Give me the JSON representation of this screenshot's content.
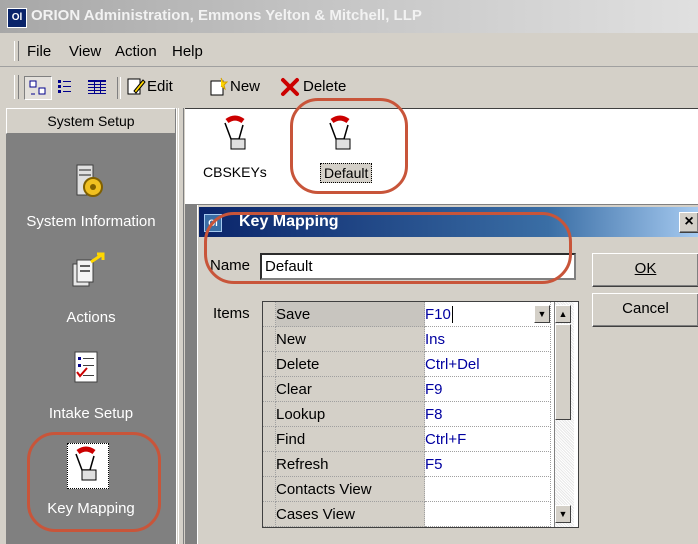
{
  "window": {
    "title": "ORION Administration, Emmons Yelton & Mitchell, LLP",
    "app_icon": "Ol"
  },
  "menu": [
    "File",
    "View",
    "Action",
    "Help"
  ],
  "toolbar": {
    "edit_label": "Edit",
    "new_label": "New",
    "delete_label": "Delete"
  },
  "sidebar": {
    "header": "System Setup",
    "items": [
      {
        "label": "System Information",
        "icon": "server-gear-icon"
      },
      {
        "label": "Actions",
        "icon": "actions-icon"
      },
      {
        "label": "Intake Setup",
        "icon": "checklist-icon"
      },
      {
        "label": "Key Mapping",
        "icon": "hand-key-icon",
        "selected": true
      }
    ]
  },
  "keymaps": [
    {
      "label": "CBSKEYs"
    },
    {
      "label": "Default",
      "selected": true
    }
  ],
  "dialog": {
    "title": "Key Mapping",
    "close_label": "×",
    "name_label": "Name",
    "name_value": "Default",
    "items_label": "Items",
    "ok_label": "OK",
    "cancel_label": "Cancel",
    "rows": [
      {
        "action": "Save",
        "key": "F10"
      },
      {
        "action": "New",
        "key": "Ins"
      },
      {
        "action": "Delete",
        "key": "Ctrl+Del"
      },
      {
        "action": "Clear",
        "key": "F9"
      },
      {
        "action": "Lookup",
        "key": "F8"
      },
      {
        "action": "Find",
        "key": "Ctrl+F"
      },
      {
        "action": "Refresh",
        "key": "F5"
      },
      {
        "action": "Contacts View",
        "key": ""
      },
      {
        "action": "Cases View",
        "key": ""
      }
    ]
  },
  "colors": {
    "annotation": "#c8553a",
    "title_gradient_start": "#0a246a",
    "key_text": "#0000a0"
  }
}
